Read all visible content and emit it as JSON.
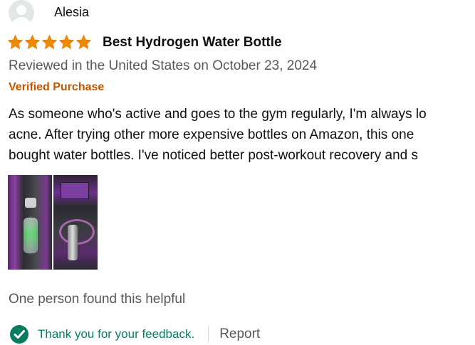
{
  "profile": {
    "name": "Alesia",
    "avatar_icon": "default-user-avatar"
  },
  "review": {
    "rating": 5,
    "rating_max": 5,
    "title": "Best Hydrogen Water Bottle",
    "meta": "Reviewed in the United States on October 23, 2024",
    "badge": "Verified Purchase",
    "body_lines": [
      "As someone who's active and goes to the gym regularly, I'm always lo",
      "acne. After trying other more expensive bottles on Amazon, this one",
      "bought water bottles. I've noticed better post-workout recovery and s"
    ],
    "images": [
      "review-photo-1",
      "review-photo-2"
    ]
  },
  "helpful_text": "One person found this helpful",
  "feedback": {
    "status_icon": "check-circle-icon",
    "message": "Thank you for your feedback.",
    "report_label": "Report"
  },
  "colors": {
    "star": "#f08804",
    "verified": "#c45500",
    "feedback_green": "#067d62",
    "secondary_text": "#565959"
  }
}
